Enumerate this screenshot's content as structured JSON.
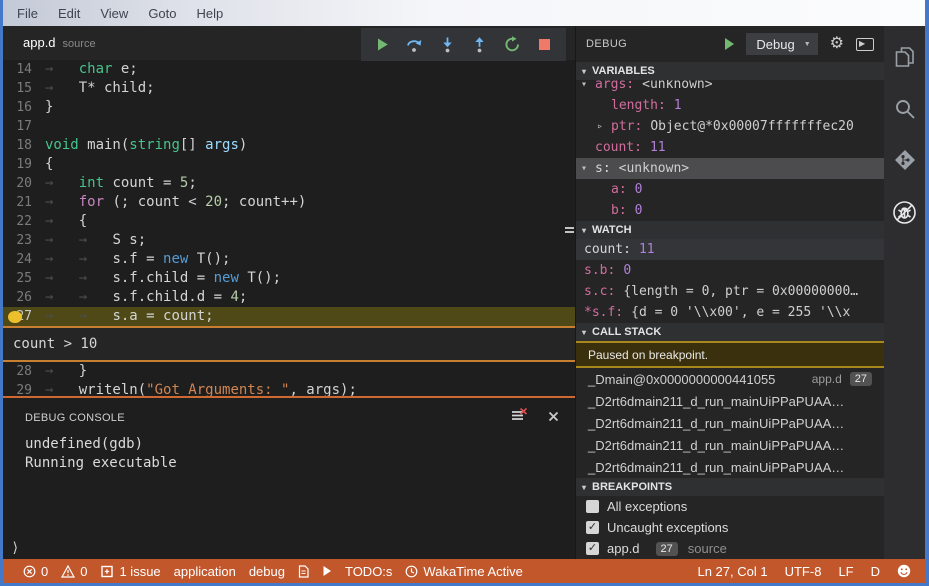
{
  "colors": {
    "window_border": "#4478c8",
    "statusbar": "#c2572c",
    "breakpoint": "#ecc02c",
    "current_line": "#4e4917",
    "console_border": "#ce6a31"
  },
  "menu": {
    "items": [
      "File",
      "Edit",
      "View",
      "Goto",
      "Help"
    ]
  },
  "tab": {
    "name": "app.d",
    "type_label": "source"
  },
  "editor": {
    "current_line": "27",
    "breakpoint_condition": "count > 10",
    "lines": [
      {
        "n": "14",
        "segs": [
          [
            "→   ",
            "ws"
          ],
          [
            "char",
            "type"
          ],
          [
            " e;",
            "fg"
          ]
        ]
      },
      {
        "n": "15",
        "segs": [
          [
            "→   ",
            "ws"
          ],
          [
            "T* child;",
            "fg"
          ]
        ]
      },
      {
        "n": "16",
        "segs": [
          [
            "}",
            "fg"
          ]
        ]
      },
      {
        "n": "17",
        "segs": []
      },
      {
        "n": "18",
        "segs": [
          [
            "void",
            "type"
          ],
          [
            " main(",
            "fg"
          ],
          [
            "string",
            "type"
          ],
          [
            "[] ",
            "fg"
          ],
          [
            "args",
            "param"
          ],
          [
            ")",
            "fg"
          ]
        ]
      },
      {
        "n": "19",
        "segs": [
          [
            "{",
            "fg"
          ]
        ]
      },
      {
        "n": "20",
        "segs": [
          [
            "→   ",
            "ws"
          ],
          [
            "int",
            "type"
          ],
          [
            " count = ",
            "fg"
          ],
          [
            "5",
            "num"
          ],
          [
            ";",
            "fg"
          ]
        ]
      },
      {
        "n": "21",
        "segs": [
          [
            "→   ",
            "ws"
          ],
          [
            "for",
            "ctrl"
          ],
          [
            " (; count < ",
            "fg"
          ],
          [
            "20",
            "num"
          ],
          [
            "; count++)",
            "fg"
          ]
        ]
      },
      {
        "n": "22",
        "segs": [
          [
            "→   ",
            "ws"
          ],
          [
            "{",
            "fg"
          ]
        ]
      },
      {
        "n": "23",
        "segs": [
          [
            "→   →   ",
            "ws"
          ],
          [
            "S s;",
            "fg"
          ]
        ]
      },
      {
        "n": "24",
        "segs": [
          [
            "→   →   ",
            "ws"
          ],
          [
            "s.f = ",
            "fg"
          ],
          [
            "new",
            "new"
          ],
          [
            " T();",
            "fg"
          ]
        ]
      },
      {
        "n": "25",
        "segs": [
          [
            "→   →   ",
            "ws"
          ],
          [
            "s.f.child = ",
            "fg"
          ],
          [
            "new",
            "new"
          ],
          [
            " T();",
            "fg"
          ]
        ]
      },
      {
        "n": "26",
        "segs": [
          [
            "→   →   ",
            "ws"
          ],
          [
            "s.f.child.d = ",
            "fg"
          ],
          [
            "4",
            "num"
          ],
          [
            ";",
            "fg"
          ]
        ]
      },
      {
        "n": "27",
        "segs": [
          [
            "→   →   ",
            "ws"
          ],
          [
            "s.a = count;",
            "fg"
          ]
        ]
      },
      {
        "n": "28",
        "segs": [
          [
            "→   ",
            "ws"
          ],
          [
            "}",
            "fg"
          ]
        ]
      },
      {
        "n": "29",
        "segs": [
          [
            "→   ",
            "ws"
          ],
          [
            "writeln(",
            "fg"
          ],
          [
            "\"Got Arguments: \"",
            "str"
          ],
          [
            ", args);",
            "fg"
          ]
        ]
      }
    ]
  },
  "console": {
    "title": "DEBUG CONSOLE",
    "output": [
      "undefined(gdb)",
      "Running executable"
    ],
    "prompt": "⟩"
  },
  "debug_panel": {
    "title": "DEBUG",
    "profile": "Debug",
    "sections": {
      "variables": "VARIABLES",
      "watch": "WATCH",
      "call_stack": "CALL STACK",
      "breakpoints": "BREAKPOINTS"
    },
    "variables": [
      {
        "name": "args:",
        "value": "<unknown>",
        "expander": "expanded",
        "level": 0,
        "value_style": "plain"
      },
      {
        "name": "length:",
        "value": "1",
        "level": 1,
        "value_style": "num"
      },
      {
        "name": "ptr:",
        "value": "Object@*0x00007fffffffec20",
        "expander": "collapsed",
        "level": 1,
        "value_style": "plain"
      },
      {
        "name": "count:",
        "value": "11",
        "level": 0,
        "value_style": "num"
      },
      {
        "name": "s:",
        "value": "<unknown>",
        "expander": "expanded",
        "level": 0,
        "selected": true,
        "name_style": "plain",
        "value_style": "plain"
      },
      {
        "name": "a:",
        "value": "0",
        "level": 1,
        "value_style": "num"
      },
      {
        "name": "b:",
        "value": "0",
        "level": 1,
        "value_style": "num"
      }
    ],
    "watch": [
      {
        "name": "count:",
        "value": "11",
        "selected": true,
        "name_style": "plain",
        "value_style": "num"
      },
      {
        "name": "s.b:",
        "value": "0",
        "value_style": "num"
      },
      {
        "name": "s.c:",
        "value": "{length = 0, ptr = 0x00000000…",
        "value_style": "plain"
      },
      {
        "name": "*s.f:",
        "value": "{d = 0 '\\\\x00', e = 255 '\\\\x",
        "value_style": "plain"
      }
    ],
    "call_stack": {
      "status": "Paused on breakpoint.",
      "frames": [
        {
          "name": "_Dmain@0x0000000000441055",
          "file": "app.d",
          "line": "27"
        },
        {
          "name": "_D2rt6dmain211_d_run_mainUiPPaPUAA…"
        },
        {
          "name": "_D2rt6dmain211_d_run_mainUiPPaPUAA…"
        },
        {
          "name": "_D2rt6dmain211_d_run_mainUiPPaPUAA…"
        },
        {
          "name": "_D2rt6dmain211_d_run_mainUiPPaPUAA…"
        }
      ]
    },
    "breakpoints": [
      {
        "checked": false,
        "label": "All exceptions"
      },
      {
        "checked": true,
        "label": "Uncaught exceptions"
      },
      {
        "checked": true,
        "label": "app.d",
        "badge": "27",
        "suffix": "source"
      }
    ]
  },
  "status_bar": {
    "left": [
      {
        "icon": "error-icon",
        "text": "0"
      },
      {
        "icon": "warning-icon",
        "text": "0"
      },
      {
        "icon": "issues-icon",
        "text": "1 issue"
      },
      {
        "text": "application"
      },
      {
        "text": "debug"
      },
      {
        "icon": "report-icon"
      },
      {
        "icon": "run-icon"
      },
      {
        "text": "TODO:s"
      },
      {
        "icon": "clock-icon",
        "text": "WakaTime Active"
      }
    ],
    "right": [
      {
        "text": "Ln 27, Col 1"
      },
      {
        "text": "UTF-8"
      },
      {
        "text": "LF"
      },
      {
        "text": "D"
      },
      {
        "icon": "smiley-icon"
      }
    ]
  }
}
